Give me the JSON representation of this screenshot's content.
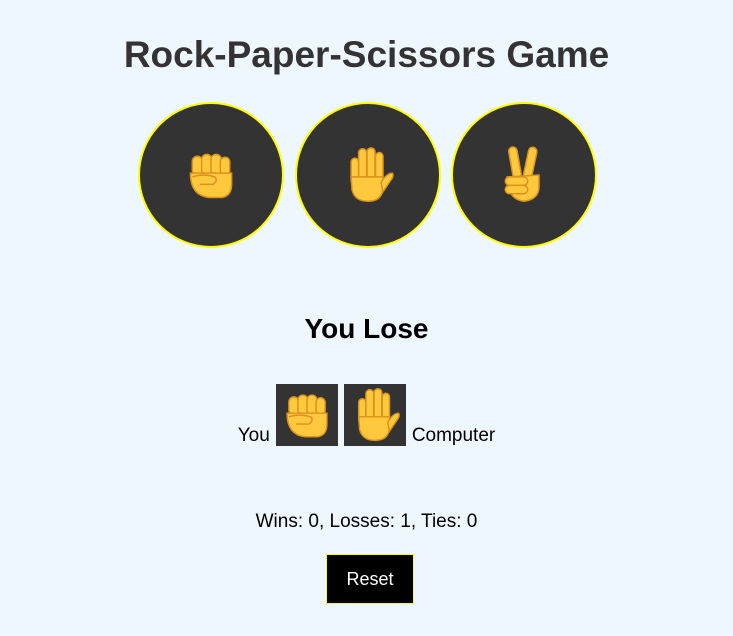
{
  "title": "Rock-Paper-Scissors Game",
  "choices": [
    {
      "id": "rock",
      "icon": "fist-emoji-icon"
    },
    {
      "id": "paper",
      "icon": "raised-hand-emoji-icon"
    },
    {
      "id": "scissors",
      "icon": "victory-hand-emoji-icon"
    }
  ],
  "result": {
    "text": "You Lose",
    "you_label": "You",
    "computer_label": "Computer",
    "you_pick": "rock",
    "computer_pick": "paper"
  },
  "score": {
    "text": "Wins: 0, Losses: 1, Ties: 0",
    "wins": 0,
    "losses": 1,
    "ties": 0
  },
  "reset_label": "Reset",
  "colors": {
    "background": "#eff7fe",
    "button_fill": "#333333",
    "button_border": "#ffff00",
    "emoji": "#ffc83d",
    "reset_fill": "#000000"
  }
}
